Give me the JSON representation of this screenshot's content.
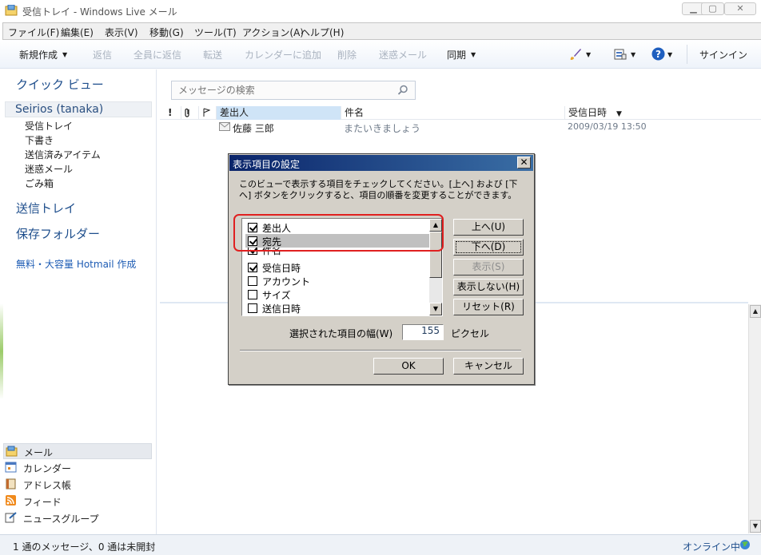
{
  "window": {
    "title": "受信トレイ - Windows Live メール"
  },
  "menu": [
    "ファイル(F)",
    "編集(E)",
    "表示(V)",
    "移動(G)",
    "ツール(T)",
    "アクション(A)",
    "ヘルプ(H)"
  ],
  "toolbar": {
    "new": "新規作成",
    "reply": "返信",
    "reply_all": "全員に返信",
    "forward": "転送",
    "add_calendar": "カレンダーに追加",
    "delete": "削除",
    "junk": "迷惑メール",
    "sync": "同期",
    "signin": "サインイン"
  },
  "sidebar": {
    "quick_view": "クイック ビュー",
    "account": "Seirios (tanaka)",
    "folders": [
      "受信トレイ",
      "下書き",
      "送信済みアイテム",
      "迷惑メール",
      "ごみ箱"
    ],
    "sent_tray": "送信トレイ",
    "storage": "保存フォルダー",
    "hotmail": "無料・大容量 Hotmail 作成",
    "nav": [
      "メール",
      "カレンダー",
      "アドレス帳",
      "フィード",
      "ニュースグループ"
    ]
  },
  "search": {
    "placeholder": "メッセージの検索"
  },
  "list": {
    "col_flag_important": "!",
    "col_sender": "差出人",
    "col_subject": "件名",
    "col_received": "受信日時",
    "message": {
      "sender": "佐藤 三郎",
      "subject": "またいきましょう",
      "received": "2009/03/19 13:50"
    }
  },
  "dialog": {
    "title": "表示項目の設定",
    "close": "✕",
    "description": "このビューで表示する項目をチェックしてください。[上へ] および [下へ] ボタンをクリックすると、項目の順番を変更することができます。",
    "columns": [
      {
        "label": "差出人",
        "checked": true
      },
      {
        "label": "宛先",
        "checked": true
      },
      {
        "label": "件名",
        "checked": true
      },
      {
        "label": "受信日時",
        "checked": true
      },
      {
        "label": "アカウント",
        "checked": false
      },
      {
        "label": "サイズ",
        "checked": false
      },
      {
        "label": "送信日時",
        "checked": false
      }
    ],
    "buttons": {
      "up": "上へ(U)",
      "down": "下へ(D)",
      "show": "表示(S)",
      "hide": "表示しない(H)",
      "reset": "リセット(R)",
      "ok": "OK",
      "cancel": "キャンセル"
    },
    "width_label": "選択された項目の幅(W)",
    "width_value": "155",
    "pixel_label": "ピクセル"
  },
  "status": {
    "left": "1 通のメッセージ、0 通は未開封",
    "right": "オンライン中"
  }
}
